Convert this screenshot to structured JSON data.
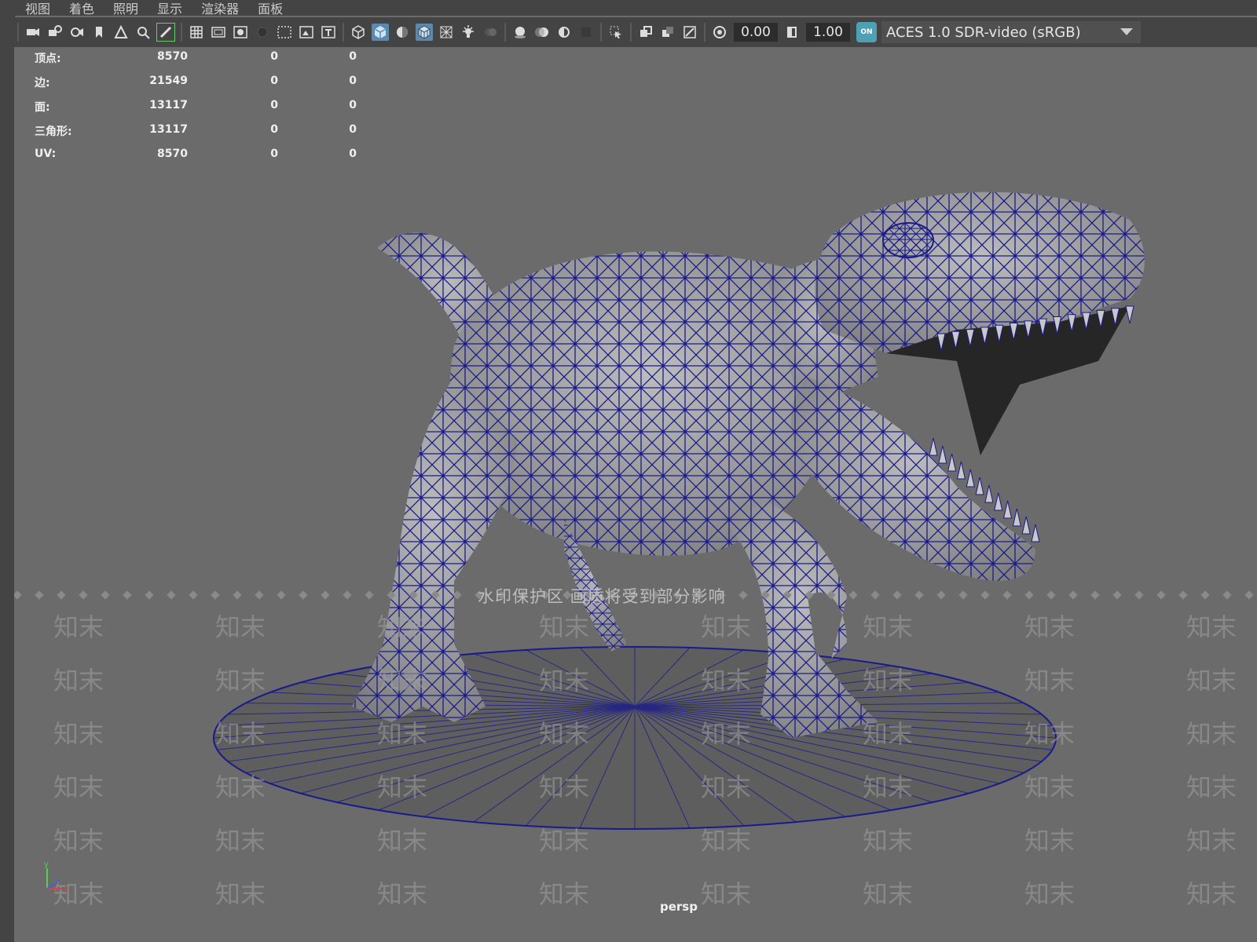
{
  "menubar": {
    "items": [
      "视图",
      "着色",
      "照明",
      "显示",
      "渲染器",
      "面板"
    ]
  },
  "toolbar": {
    "exposure_value": "0.00",
    "gamma_value": "1.00",
    "color_management_toggle": "ON",
    "color_space": "ACES 1.0 SDR-video (sRGB)"
  },
  "hud": {
    "rows": [
      {
        "label": "顶点:",
        "v1": "8570",
        "v2": "0",
        "v3": "0"
      },
      {
        "label": "边:",
        "v1": "21549",
        "v2": "0",
        "v3": "0"
      },
      {
        "label": "面:",
        "v1": "13117",
        "v2": "0",
        "v3": "0"
      },
      {
        "label": "三角形:",
        "v1": "13117",
        "v2": "0",
        "v3": "0"
      },
      {
        "label": "UV:",
        "v1": "8570",
        "v2": "0",
        "v3": "0"
      }
    ]
  },
  "viewport": {
    "camera": "persp",
    "watermark_banner": "水印保护区  画质将受到部分影响",
    "watermark_text": "知末",
    "axis_labels": {
      "x": "x",
      "y": "y",
      "z": "z"
    }
  },
  "colors": {
    "wireframe": "#1a1a8c",
    "viewport_bg": "#6b6b6b",
    "toolbar_bg": "#444444",
    "accent": "#4ea0b5"
  }
}
